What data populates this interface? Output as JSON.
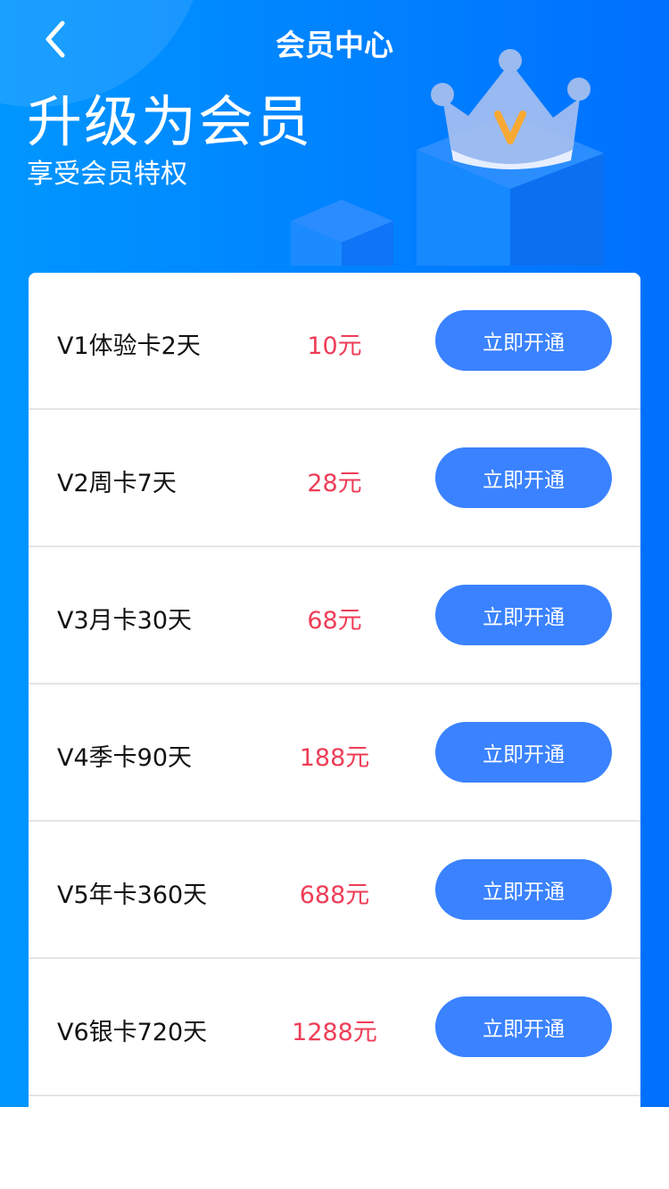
{
  "header": {
    "title": "会员中心",
    "headline": "升级为会员",
    "subheadline": "享受会员特权"
  },
  "plans": [
    {
      "name": "V1体验卡2天",
      "price": "10元",
      "button": "立即开通"
    },
    {
      "name": "V2周卡7天",
      "price": "28元",
      "button": "立即开通"
    },
    {
      "name": "V3月卡30天",
      "price": "68元",
      "button": "立即开通"
    },
    {
      "name": "V4季卡90天",
      "price": "188元",
      "button": "立即开通"
    },
    {
      "name": "V5年卡360天",
      "price": "688元",
      "button": "立即开通"
    },
    {
      "name": "V6银卡720天",
      "price": "1288元",
      "button": "立即开通"
    }
  ],
  "colors": {
    "accent": "#3a82ff",
    "price": "#ee3d57",
    "header_start": "#0096ff",
    "header_end": "#0070ff"
  }
}
